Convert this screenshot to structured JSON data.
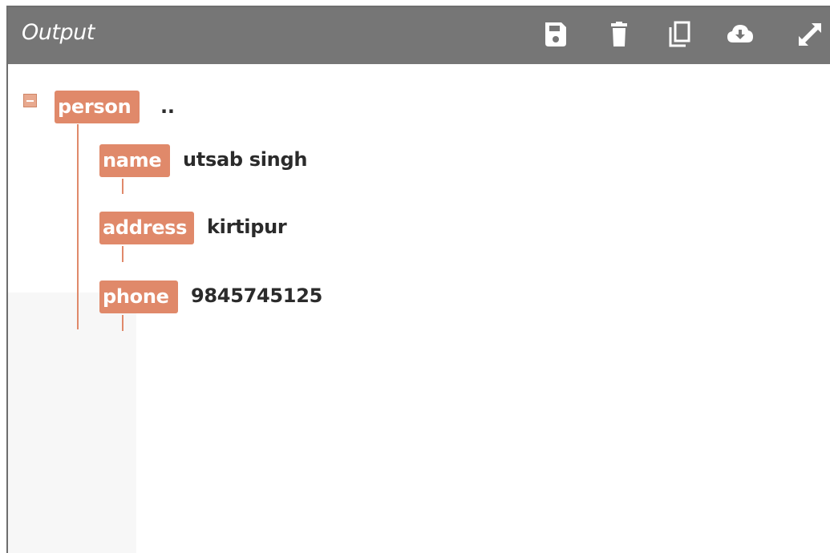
{
  "toolbar": {
    "title": "Output",
    "buttons": [
      {
        "icon": "save-icon"
      },
      {
        "icon": "trash-icon"
      },
      {
        "icon": "copy-icon"
      },
      {
        "icon": "cloud-download-icon"
      },
      {
        "icon": "expand-icon"
      }
    ]
  },
  "tree": {
    "root": {
      "key": "person",
      "value": "..",
      "expanded": true
    },
    "children": [
      {
        "key": "name",
        "value": "utsab singh"
      },
      {
        "key": "address",
        "value": "kirtipur"
      },
      {
        "key": "phone",
        "value": "9845745125"
      }
    ]
  },
  "colors": {
    "toolbar_bg": "#767676",
    "tag_bg": "#e0896a",
    "value_text": "#2b2b2b"
  }
}
